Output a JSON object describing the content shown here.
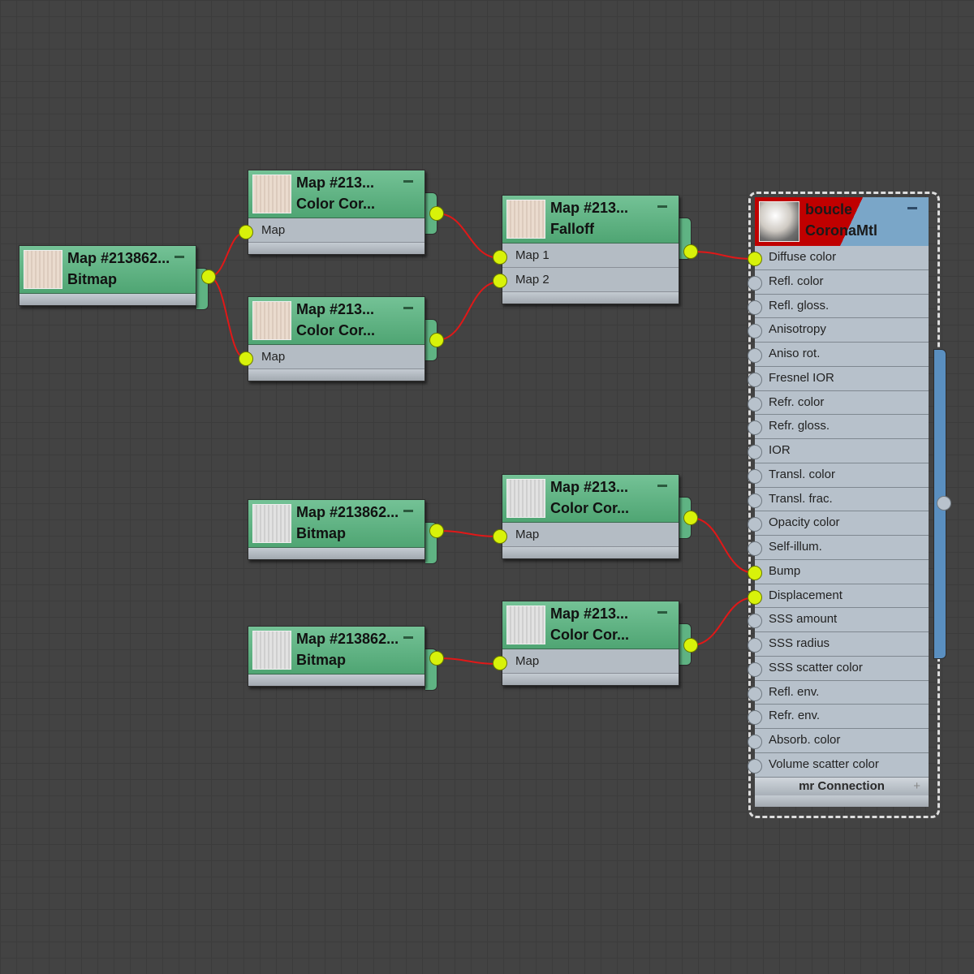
{
  "nodes": [
    {
      "title": "Map #213862...",
      "type": "Bitmap",
      "inputs": []
    },
    {
      "title": "Map #213...",
      "type": "Color Cor...",
      "inputs": [
        "Map"
      ]
    },
    {
      "title": "Map #213...",
      "type": "Color Cor...",
      "inputs": [
        "Map"
      ]
    },
    {
      "title": "Map #213...",
      "type": "Falloff",
      "inputs": [
        "Map 1",
        "Map 2"
      ]
    },
    {
      "title": "Map #213862...",
      "type": "Bitmap",
      "inputs": []
    },
    {
      "title": "Map #213...",
      "type": "Color Cor...",
      "inputs": [
        "Map"
      ]
    },
    {
      "title": "Map #213862...",
      "type": "Bitmap",
      "inputs": []
    },
    {
      "title": "Map #213...",
      "type": "Color Cor...",
      "inputs": [
        "Map"
      ]
    }
  ],
  "material": {
    "name": "boucle",
    "type": "CoronaMtl",
    "slots": [
      "Diffuse color",
      "Refl. color",
      "Refl. gloss.",
      "Anisotropy",
      "Aniso rot.",
      "Fresnel IOR",
      "Refr. color",
      "Refr. gloss.",
      "IOR",
      "Transl. color",
      "Transl. frac.",
      "Opacity color",
      "Self-illum.",
      "Bump",
      "Displacement",
      "SSS amount",
      "SSS radius",
      "SSS scatter color",
      "Refl. env.",
      "Refr. env.",
      "Absorb. color",
      "Volume scatter color"
    ],
    "connected_slots": [
      0,
      13,
      14
    ],
    "footer": "mr Connection",
    "footer_icon": "+"
  },
  "colors": {
    "wire": "#e01818",
    "port_on": "#d8f20a",
    "node_header": "#5fb383",
    "material_header": "#c00000"
  }
}
